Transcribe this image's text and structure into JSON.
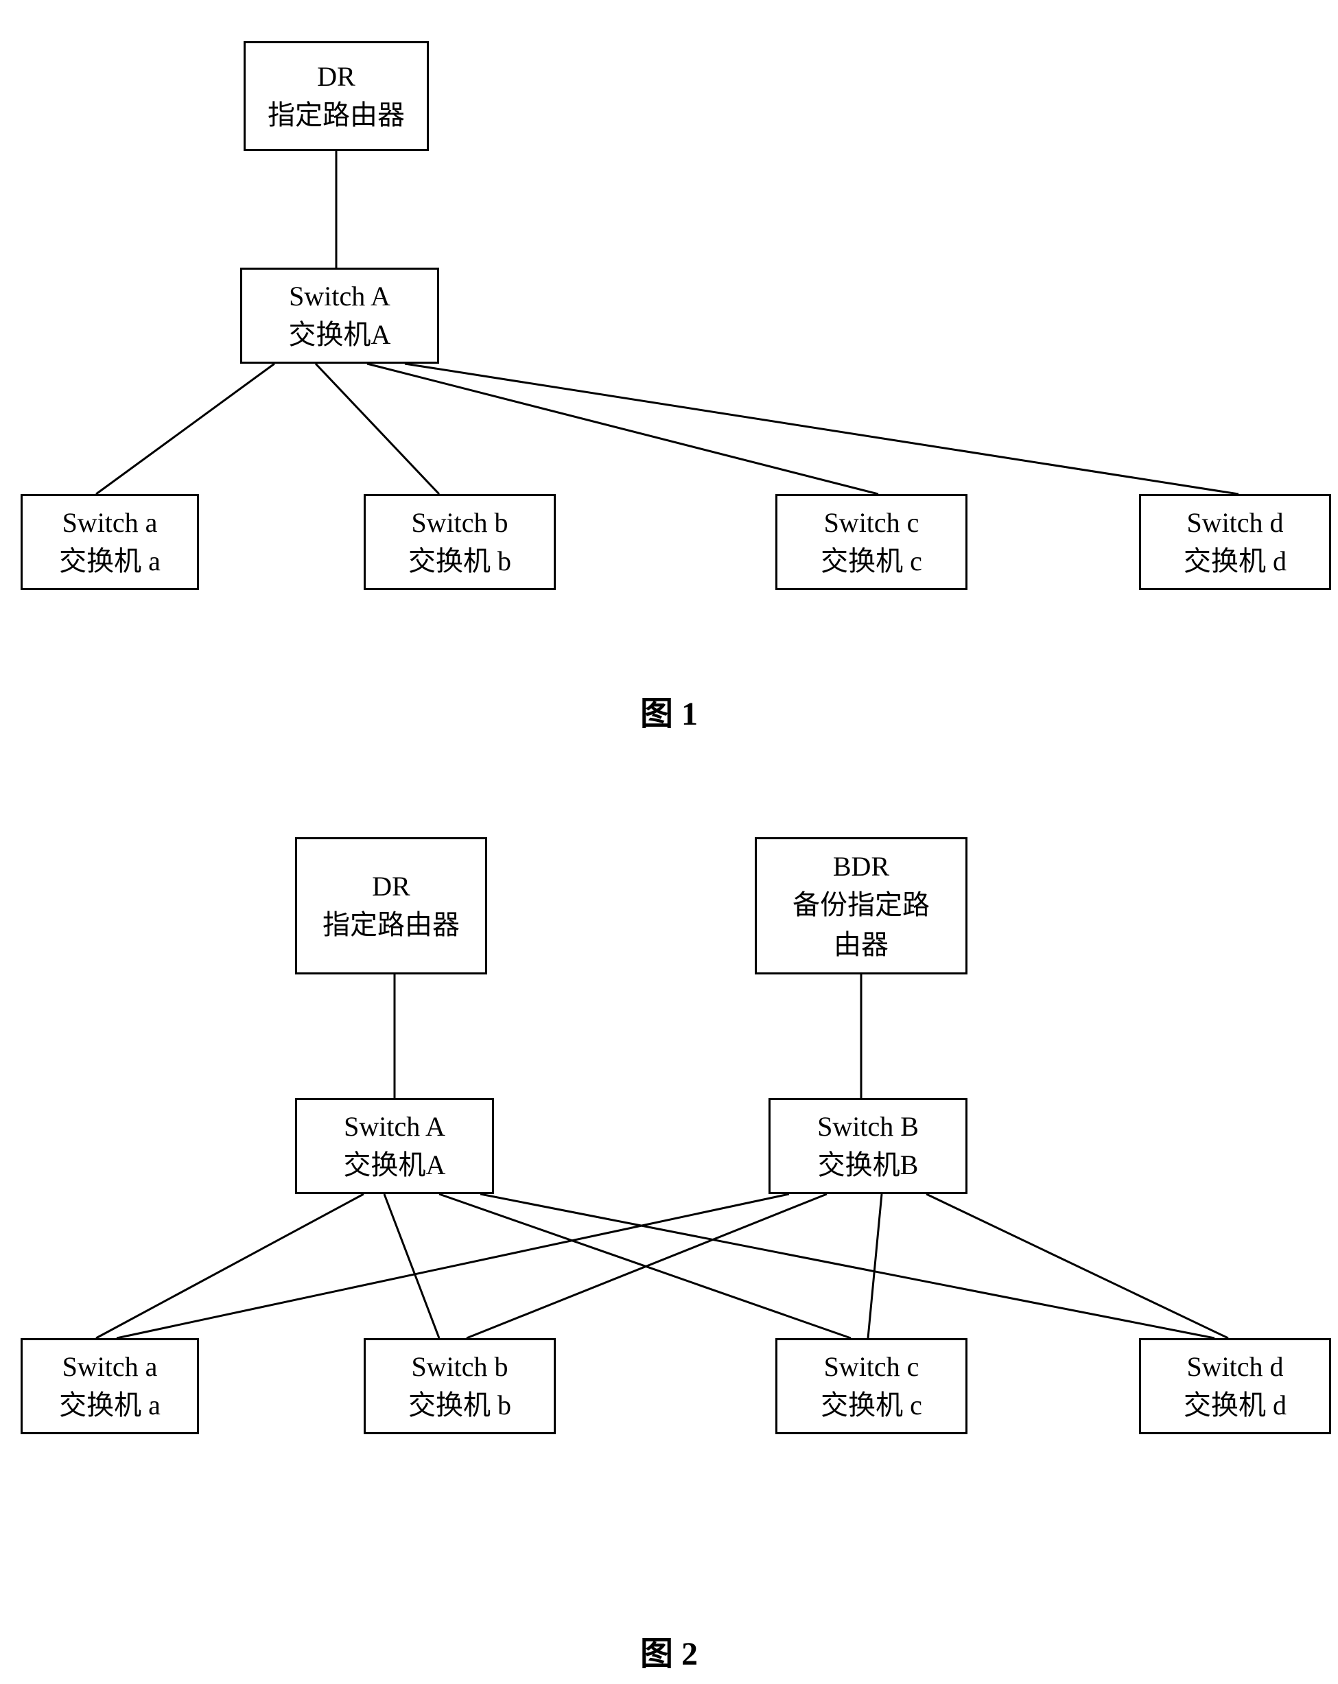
{
  "diagram1": {
    "dr": {
      "line1": "DR",
      "line2": "指定路由器"
    },
    "switchA": {
      "line1": "Switch A",
      "line2": "交换机A"
    },
    "switcha": {
      "line1": "Switch a",
      "line2": "交换机 a"
    },
    "switchb": {
      "line1": "Switch b",
      "line2": "交换机 b"
    },
    "switchc": {
      "line1": "Switch c",
      "line2": "交换机 c"
    },
    "switchd": {
      "line1": "Switch d",
      "line2": "交换机 d"
    },
    "caption": "图 1"
  },
  "diagram2": {
    "dr": {
      "line1": "DR",
      "line2": "指定路由器"
    },
    "bdr": {
      "line1": "BDR",
      "line2": "备份指定路",
      "line3": "由器"
    },
    "switchA": {
      "line1": "Switch A",
      "line2": "交换机A"
    },
    "switchB": {
      "line1": "Switch B",
      "line2": "交换机B"
    },
    "switcha": {
      "line1": "Switch a",
      "line2": "交换机 a"
    },
    "switchb": {
      "line1": "Switch b",
      "line2": "交换机 b"
    },
    "switchc": {
      "line1": "Switch c",
      "line2": "交换机 c"
    },
    "switchd": {
      "line1": "Switch d",
      "line2": "交换机 d"
    },
    "caption": "图 2"
  }
}
